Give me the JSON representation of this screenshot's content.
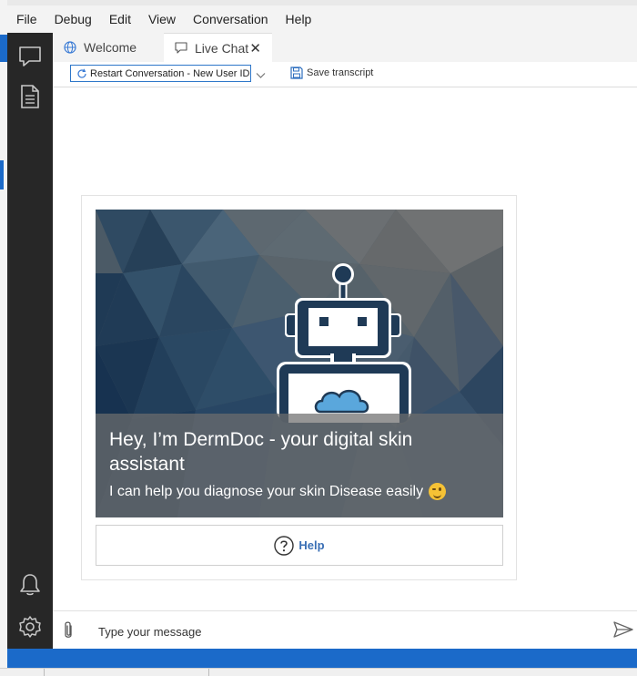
{
  "menu": {
    "items": [
      "File",
      "Debug",
      "Edit",
      "View",
      "Conversation",
      "Help"
    ]
  },
  "activity_bar": {
    "icons": [
      "chat-icon",
      "document-icon",
      "bell-icon",
      "gear-icon"
    ]
  },
  "tabs": [
    {
      "label": "Welcome",
      "icon": "globe-icon",
      "active": false
    },
    {
      "label": "Live Chat",
      "icon": "chat-icon",
      "active": true
    }
  ],
  "toolbar": {
    "restart_label": "Restart Conversation - New User ID",
    "save_label": "Save transcript"
  },
  "card": {
    "title": "Hey, I’m DermDoc - your digital skin assistant",
    "subtitle": "I can help you diagnose your skin Disease easily",
    "button_label": "Help"
  },
  "composer": {
    "placeholder": "Type your message"
  },
  "colors": {
    "accent": "#1b6ac9",
    "activity_bar": "#272727",
    "robot": "#1f3a56",
    "cloud": "#5aa7dc",
    "help_text": "#3a6fb5"
  }
}
